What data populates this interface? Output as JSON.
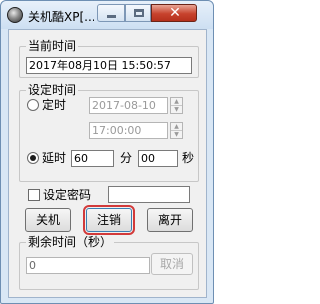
{
  "window": {
    "title": "关机酷XP[...",
    "minimize_icon": "minimize-icon",
    "maximize_icon": "maximize-icon",
    "close_icon": "close-icon",
    "close_glyph": "✕"
  },
  "current_time": {
    "legend": "当前时间",
    "value": "2017年08月10日    15:50:57"
  },
  "set_time": {
    "legend": "设定时间",
    "fixed_label": "定时",
    "date_value": "2017-08-10",
    "time_value": "17:00:00",
    "delay_label": "延时",
    "minutes_value": "60",
    "minutes_unit": "分",
    "seconds_value": "00",
    "seconds_unit": "秒",
    "selected_mode": "延时"
  },
  "password": {
    "label": "设定密码",
    "value": ""
  },
  "actions": {
    "shutdown": "关机",
    "logoff": "注销",
    "leave": "离开"
  },
  "remaining": {
    "legend": "剩余时间（秒）",
    "value": "0",
    "cancel": "取消"
  }
}
